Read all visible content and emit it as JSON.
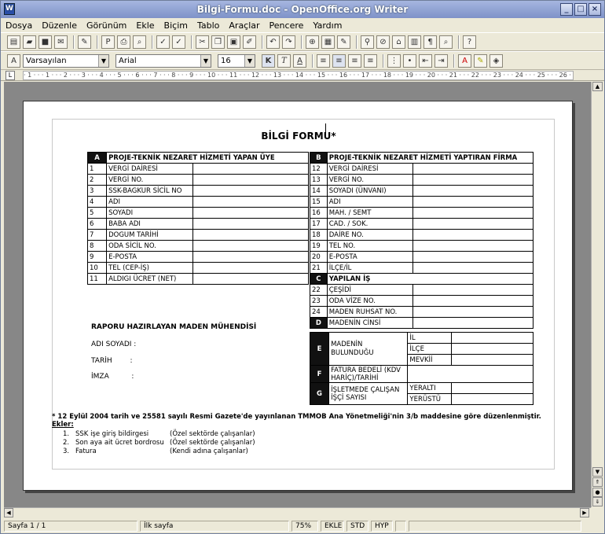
{
  "window": {
    "title": "Bilgi-Formu.doc - OpenOffice.org Writer"
  },
  "menu": [
    "Dosya",
    "Düzenle",
    "Görünüm",
    "Ekle",
    "Biçim",
    "Tablo",
    "Araçlar",
    "Pencere",
    "Yardım"
  ],
  "formatting": {
    "style": "Varsayılan",
    "font": "Arial",
    "size": "16",
    "bold_label": "K",
    "italic_label": "T",
    "underline_label": "A"
  },
  "ruler": {
    "marks": "· 1 · · · 1 · · · 2 · · · 3 · · · 4 · · · 5 · · · 6 · · · 7 · · · 8 · · · 9 · · · 10 · · · 11 · · · 12 · · · 13 · · · 14 · · · 15 · · · 16 · · · 17 · · · 18 · · · 19 · · · 20 · · · 21 · · · 22 · · · 23 · · · 24 · · · 25 · · · 26 · · · 27 · · 28"
  },
  "document": {
    "title": "BİLGİ FORMU*",
    "sectionA": {
      "letter": "A",
      "header": "PROJE-TEKNİK NEZARET HİZMETİ YAPAN ÜYE",
      "rows": [
        {
          "n": "1",
          "label": "VERGİ DAİRESİ"
        },
        {
          "n": "2",
          "label": "VERGİ NO."
        },
        {
          "n": "3",
          "label": "SSK-BAGKUR SİCİL NO"
        },
        {
          "n": "4",
          "label": "ADI"
        },
        {
          "n": "5",
          "label": "SOYADI"
        },
        {
          "n": "6",
          "label": "BABA ADI"
        },
        {
          "n": "7",
          "label": "DOGUM TARİHİ"
        },
        {
          "n": "8",
          "label": "ODA SİCİL NO."
        },
        {
          "n": "9",
          "label": "E-POSTA"
        },
        {
          "n": "10",
          "label": "TEL (CEP-İŞ)"
        },
        {
          "n": "11",
          "label": "ALDIGI ÜCRET (NET)"
        }
      ]
    },
    "sectionB": {
      "letter": "B",
      "header": "PROJE-TEKNİK NEZARET HİZMETİ YAPTIRAN FİRMA",
      "rows": [
        {
          "n": "12",
          "label": "VERGİ DAİRESİ"
        },
        {
          "n": "13",
          "label": "VERGİ NO."
        },
        {
          "n": "14",
          "label": "SOYADI (ÜNVANI)"
        },
        {
          "n": "15",
          "label": "ADI"
        },
        {
          "n": "16",
          "label": "MAH. / SEMT"
        },
        {
          "n": "17",
          "label": "CAD. / SOK."
        },
        {
          "n": "18",
          "label": "DAİRE NO."
        },
        {
          "n": "19",
          "label": "TEL NO."
        },
        {
          "n": "20",
          "label": "E-POSTA"
        },
        {
          "n": "21",
          "label": "İLÇE/İL"
        }
      ]
    },
    "sectionC": {
      "letter": "C",
      "header": "YAPILAN İŞ",
      "rows": [
        {
          "n": "22",
          "label": "ÇEŞİDİ"
        },
        {
          "n": "23",
          "label": "ODA VİZE NO."
        },
        {
          "n": "24",
          "label": "MADEN RUHSAT NO."
        }
      ]
    },
    "sectionD": {
      "letter": "D",
      "label": "MADENİN CİNSİ"
    },
    "sectionE": {
      "letter": "E",
      "label": "MADENİN BULUNDUĞU",
      "subs": [
        "İL",
        "İLÇE",
        "MEVKİİ"
      ]
    },
    "sectionF": {
      "letter": "F",
      "label": "FATURA BEDELİ (KDV HARİÇ)/TARİHİ"
    },
    "sectionG": {
      "letter": "G",
      "label": "İŞLETMEDE ÇALIŞAN İŞÇİ SAYISI",
      "subs": [
        "YERALTI",
        "YERÜSTÜ"
      ]
    },
    "engineer": {
      "heading": "RAPORU HAZIRLAYAN MADEN MÜHENDİSİ",
      "name": "ADI SOYADI :",
      "date": "TARİH        :",
      "sign": "İMZA          :"
    },
    "footnote": "* 12 Eylül 2004 tarih ve 25581 sayılı Resmi Gazete'de yayınlanan TMMOB Ana Yönetmeliği'nin 3/b maddesine göre düzenlenmiştir.",
    "ekler_label": "Ekler:",
    "attachments": [
      {
        "n": "1.",
        "text": "SSK işe giriş bildirgesi",
        "note": "(Özel sektörde çalışanlar)"
      },
      {
        "n": "2.",
        "text": "Son aya ait ücret bordrosu",
        "note": "(Özel sektörde çalışanlar)"
      },
      {
        "n": "3.",
        "text": "Fatura",
        "note": "(Kendi adına çalışanlar)"
      }
    ]
  },
  "status": {
    "page": "Sayfa 1 / 1",
    "style": "İlk sayfa",
    "zoom": "75%",
    "insert": "EKLE",
    "std": "STD",
    "hyp": "HYP"
  }
}
